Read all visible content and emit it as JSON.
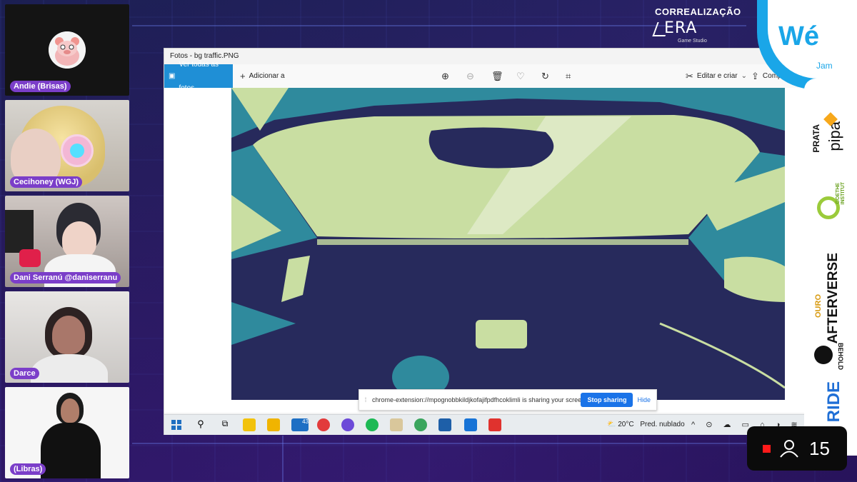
{
  "participants": [
    {
      "name": "Andie (Brisas)"
    },
    {
      "name": "Cecihoney (WGJ)"
    },
    {
      "name": "Dani Serranú @daniserranu"
    },
    {
      "name": "Darce"
    },
    {
      "name": "(Libras)"
    }
  ],
  "photos_window": {
    "title": "Fotos - bg traffic.PNG",
    "see_all_label": "Ver todas as fotos",
    "add_to_label": "Adicionar a",
    "edit_create_label": "Editar e criar",
    "share_label": "Compartilhar",
    "toolbar_icons": [
      "zoom-in-icon",
      "zoom-out-icon",
      "trash-icon",
      "heart-icon",
      "rotate-icon",
      "crop-icon"
    ]
  },
  "screen_share": {
    "message": "chrome-extension://mpognobbkildjkofajifpdfhcoklimli is sharing your screen.",
    "stop_label": "Stop sharing",
    "hide_label": "Hide"
  },
  "taskbar": {
    "weather_temp": "20°C",
    "weather_desc": "Pred. nublado",
    "mail_badge": "43"
  },
  "overlay": {
    "corr_title": "CORREALIZAÇÃO",
    "corr_logo": "ERA",
    "corr_sub": "Game Studio",
    "brand": "Wé",
    "brand_sub": "Jam",
    "viewer_count": "15"
  },
  "sponsors": [
    {
      "tier": "PRATA",
      "name": "pipa"
    },
    {
      "tier": "",
      "name": "GOETHE INSTITUT"
    },
    {
      "tier": "OURO",
      "name": "AFTERVERSE"
    },
    {
      "tier": "",
      "name": "BEHOLD"
    },
    {
      "tier": "",
      "name": "RIDE"
    }
  ],
  "colors": {
    "label_purple": "#7b3ec9",
    "accent_blue": "#1aa6e8",
    "photo_dark": "#272a5c",
    "photo_light": "#c9dea2",
    "photo_teal": "#2e8fa0"
  }
}
